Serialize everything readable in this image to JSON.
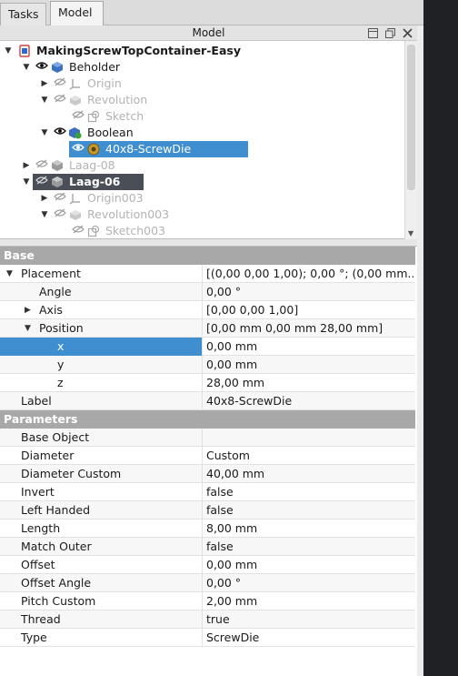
{
  "tabs": [
    {
      "label": "Tasks",
      "active": false
    },
    {
      "label": "Model",
      "active": true
    }
  ],
  "panel": {
    "title": "Model"
  },
  "tree": [
    {
      "label": "MakingScrewTopContainer-Easy",
      "bold": true,
      "hidden": false,
      "arrow": "expanded",
      "eye": "none",
      "icon": "document-icon"
    },
    {
      "label": "Beholder",
      "bold": false,
      "hidden": false,
      "arrow": "expanded",
      "eye": "visible",
      "icon": "body-icon"
    },
    {
      "label": "Origin",
      "bold": false,
      "hidden": true,
      "arrow": "collapsed",
      "eye": "hidden",
      "icon": "origin-icon"
    },
    {
      "label": "Revolution",
      "bold": false,
      "hidden": true,
      "arrow": "expanded",
      "eye": "hidden",
      "icon": "revolution-icon"
    },
    {
      "label": "Sketch",
      "bold": false,
      "hidden": true,
      "arrow": "none",
      "eye": "hidden",
      "icon": "sketch-icon"
    },
    {
      "label": "Boolean",
      "bold": false,
      "hidden": false,
      "arrow": "expanded",
      "eye": "visible",
      "icon": "boolean-icon"
    },
    {
      "label": "40x8-ScrewDie",
      "bold": false,
      "hidden": false,
      "arrow": "none",
      "eye": "visible",
      "icon": "screwdie-icon",
      "selected": true
    },
    {
      "label": "Laag-08",
      "bold": false,
      "hidden": true,
      "arrow": "collapsed",
      "eye": "hidden",
      "icon": "body-icon"
    },
    {
      "label": "Laag-06",
      "bold": true,
      "hidden": false,
      "arrow": "expanded",
      "eye": "hidden",
      "icon": "body-icon",
      "active": true
    },
    {
      "label": "Origin003",
      "bold": false,
      "hidden": true,
      "arrow": "collapsed",
      "eye": "hidden",
      "icon": "origin-icon"
    },
    {
      "label": "Revolution003",
      "bold": false,
      "hidden": true,
      "arrow": "expanded",
      "eye": "hidden",
      "icon": "revolution-icon"
    },
    {
      "label": "Sketch003",
      "bold": false,
      "hidden": true,
      "arrow": "none",
      "eye": "hidden",
      "icon": "sketch-icon"
    }
  ],
  "properties": {
    "base_group": "Base",
    "base_rows": [
      {
        "key": "Placement",
        "value": "[(0,00 0,00 1,00); 0,00 °; (0,00 mm...",
        "arrow": "expanded"
      },
      {
        "key": "Angle",
        "value": "0,00 °",
        "arrow": "none"
      },
      {
        "key": "Axis",
        "value": "[0,00 0,00 1,00]",
        "arrow": "collapsed"
      },
      {
        "key": "Position",
        "value": "[0,00 mm  0,00 mm  28,00 mm]",
        "arrow": "expanded"
      },
      {
        "key": "x",
        "value": "0,00 mm",
        "arrow": "none",
        "selected": true
      },
      {
        "key": "y",
        "value": "0,00 mm",
        "arrow": "none"
      },
      {
        "key": "z",
        "value": "28,00 mm",
        "arrow": "none"
      },
      {
        "key": "Label",
        "value": "40x8-ScrewDie",
        "arrow": "none"
      }
    ],
    "param_group": "Parameters",
    "param_rows": [
      {
        "key": "Base Object",
        "value": ""
      },
      {
        "key": "Diameter",
        "value": "Custom"
      },
      {
        "key": "Diameter Custom",
        "value": "40,00 mm"
      },
      {
        "key": "Invert",
        "value": "false"
      },
      {
        "key": "Left Handed",
        "value": "false"
      },
      {
        "key": "Length",
        "value": "8,00 mm"
      },
      {
        "key": "Match Outer",
        "value": "false"
      },
      {
        "key": "Offset",
        "value": "0,00 mm"
      },
      {
        "key": "Offset Angle",
        "value": "0,00 °"
      },
      {
        "key": "Pitch Custom",
        "value": "2,00 mm"
      },
      {
        "key": "Thread",
        "value": "true"
      },
      {
        "key": "Type",
        "value": "ScrewDie"
      }
    ]
  },
  "colors": {
    "selection": "#3e8ed0",
    "group_header": "#a8a8a8",
    "active_body": "#4a4f57"
  }
}
